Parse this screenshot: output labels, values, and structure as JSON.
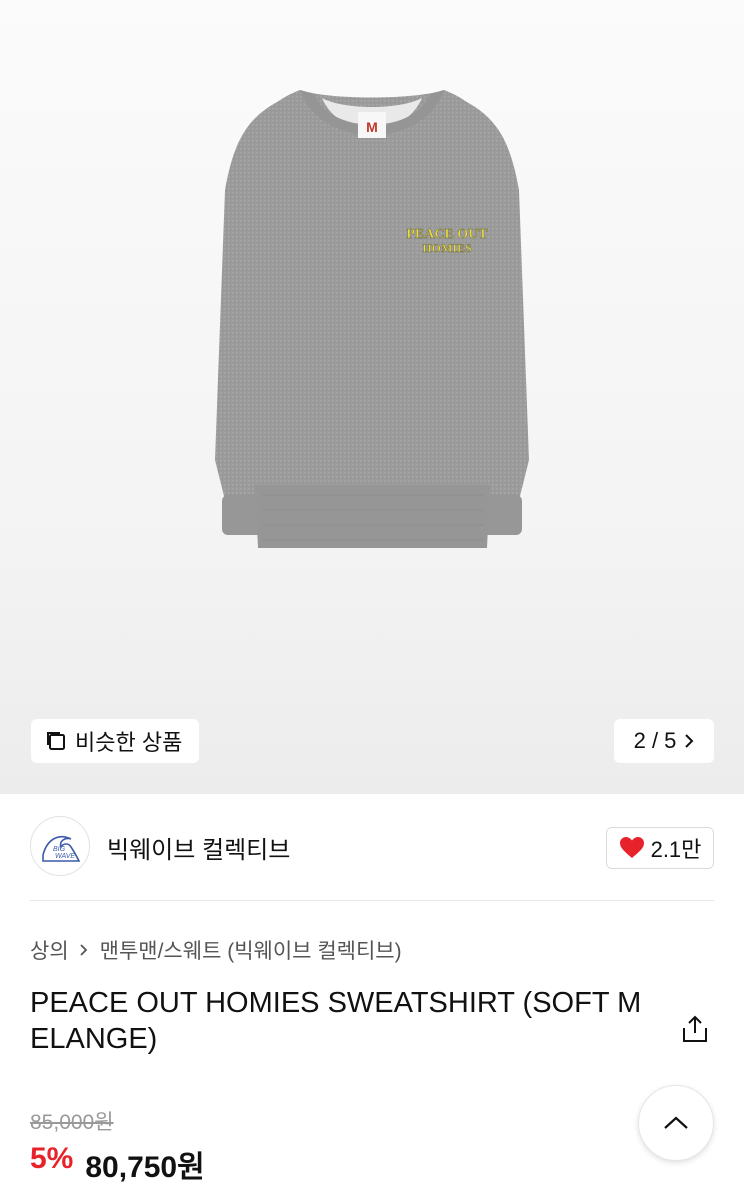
{
  "gallery": {
    "similar_label": "비슷한 상품",
    "counter": "2 / 5",
    "graphic_text_line1": "PEACE OUT",
    "graphic_text_line2": "HOMIES",
    "size_tag": "M"
  },
  "brand": {
    "name": "빅웨이브 컬렉티브",
    "logo_text_line1": "BIG",
    "logo_text_line2": "WAVE"
  },
  "like": {
    "count": "2.1만",
    "color": "#e8222a"
  },
  "breadcrumb": {
    "level1": "상의",
    "level2": "맨투맨/스웨트 (빅웨이브 컬렉티브)"
  },
  "product": {
    "title": "PEACE OUT HOMIES SWEATSHIRT (SOFT MELANGE)",
    "original_price": "85,000원",
    "discount": "5%",
    "final_price": "80,750원"
  },
  "colors": {
    "accent_red": "#e8222a",
    "sweatshirt_gray": "#9a9a9a"
  }
}
